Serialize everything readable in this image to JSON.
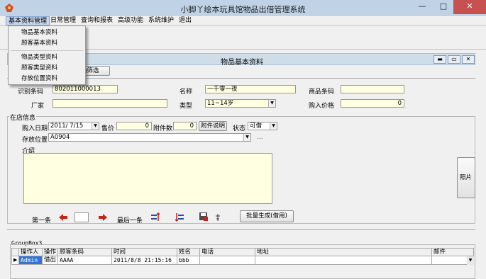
{
  "window": {
    "title": "小脚丫绘本玩具馆物品出借管理系统",
    "min": "—",
    "max": "□",
    "close": "✕"
  },
  "menu": {
    "items": [
      "基本资料管理",
      "日常管理",
      "查询和报表",
      "高级功能",
      "系统维护",
      "退出"
    ],
    "dropdown": [
      "物品基本资料",
      "顾客基本资料",
      "物品类型资料",
      "顾客类型资料",
      "存放位置资料"
    ]
  },
  "child": {
    "title": "物品基本资料",
    "tab_partial": "精确筛选"
  },
  "form": {
    "id_label": "识别条码",
    "id_value": "802011000013",
    "name_label": "名称",
    "name_value": "一千零一夜",
    "barcode_label": "商品条码",
    "barcode_value": "",
    "maker_label": "厂家",
    "maker_value": "",
    "type_label": "类型",
    "type_value": "11~14岁",
    "price_label": "购入价格",
    "price_value": "0"
  },
  "store": {
    "group_label": "在店信息",
    "date_label": "购入日期",
    "date_value": "2011/ 7/15",
    "sale_label": "售价",
    "sale_value": "0",
    "attach_label": "附件数",
    "attach_value": "0",
    "attach_btn": "附件说明",
    "status_label": "状态",
    "status_value": "可借",
    "loc_label": "存放位置",
    "loc_value": "A0904",
    "loc_dots": "...",
    "intro_label": "介绍",
    "intro_value": ""
  },
  "nav": {
    "first": "第一条",
    "last": "最后一条",
    "batch": "批量生成(借用)",
    "photo": "照片",
    "page_value": ""
  },
  "grid": {
    "group_label": "GroupBox3",
    "columns": [
      "操作人",
      "操作",
      "顾客条码",
      "时间",
      "姓名",
      "电话",
      "地址",
      "邮件"
    ],
    "rows": [
      [
        "Admin",
        "借出",
        "AAAA",
        "2011/8/8 21:15:16",
        "bbb",
        "",
        "",
        ""
      ]
    ]
  },
  "colors": {
    "accent": "#c75050",
    "input_bg": "#ffffe1",
    "chrome": "#cfdde9"
  }
}
